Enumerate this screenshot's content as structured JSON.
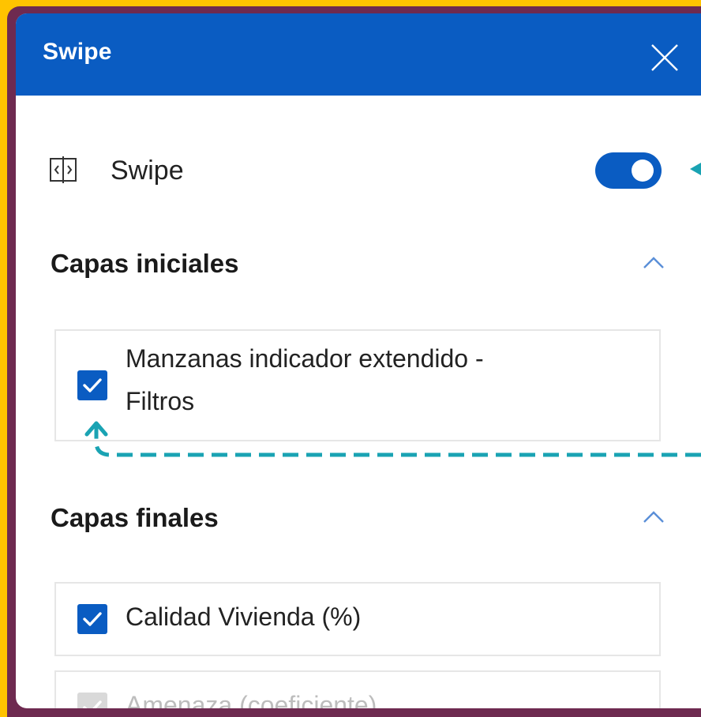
{
  "header": {
    "title": "Swipe"
  },
  "swipe": {
    "label": "Swipe",
    "enabled": true
  },
  "sections": [
    {
      "title": "Capas iniciales",
      "expanded": true,
      "layers": [
        {
          "label_line1": "Manzanas indicador extendido -",
          "label_line2": "Filtros",
          "checked": true
        }
      ]
    },
    {
      "title": "Capas finales",
      "expanded": true,
      "layers": [
        {
          "label": "Calidad Vivienda (%)",
          "checked": true
        },
        {
          "label": "Amenaza (coeficiente)",
          "checked": true,
          "disabled": true
        }
      ]
    }
  ],
  "colors": {
    "accent": "#0A5CC2",
    "frame_yellow": "#FFC300",
    "frame_purple": "#6E2A50",
    "annotation_teal": "#1AA3B3"
  },
  "icons": {
    "swipe": "swipe-icon",
    "close": "close-icon",
    "chevron": "chevron-up-icon",
    "check": "check-icon"
  }
}
